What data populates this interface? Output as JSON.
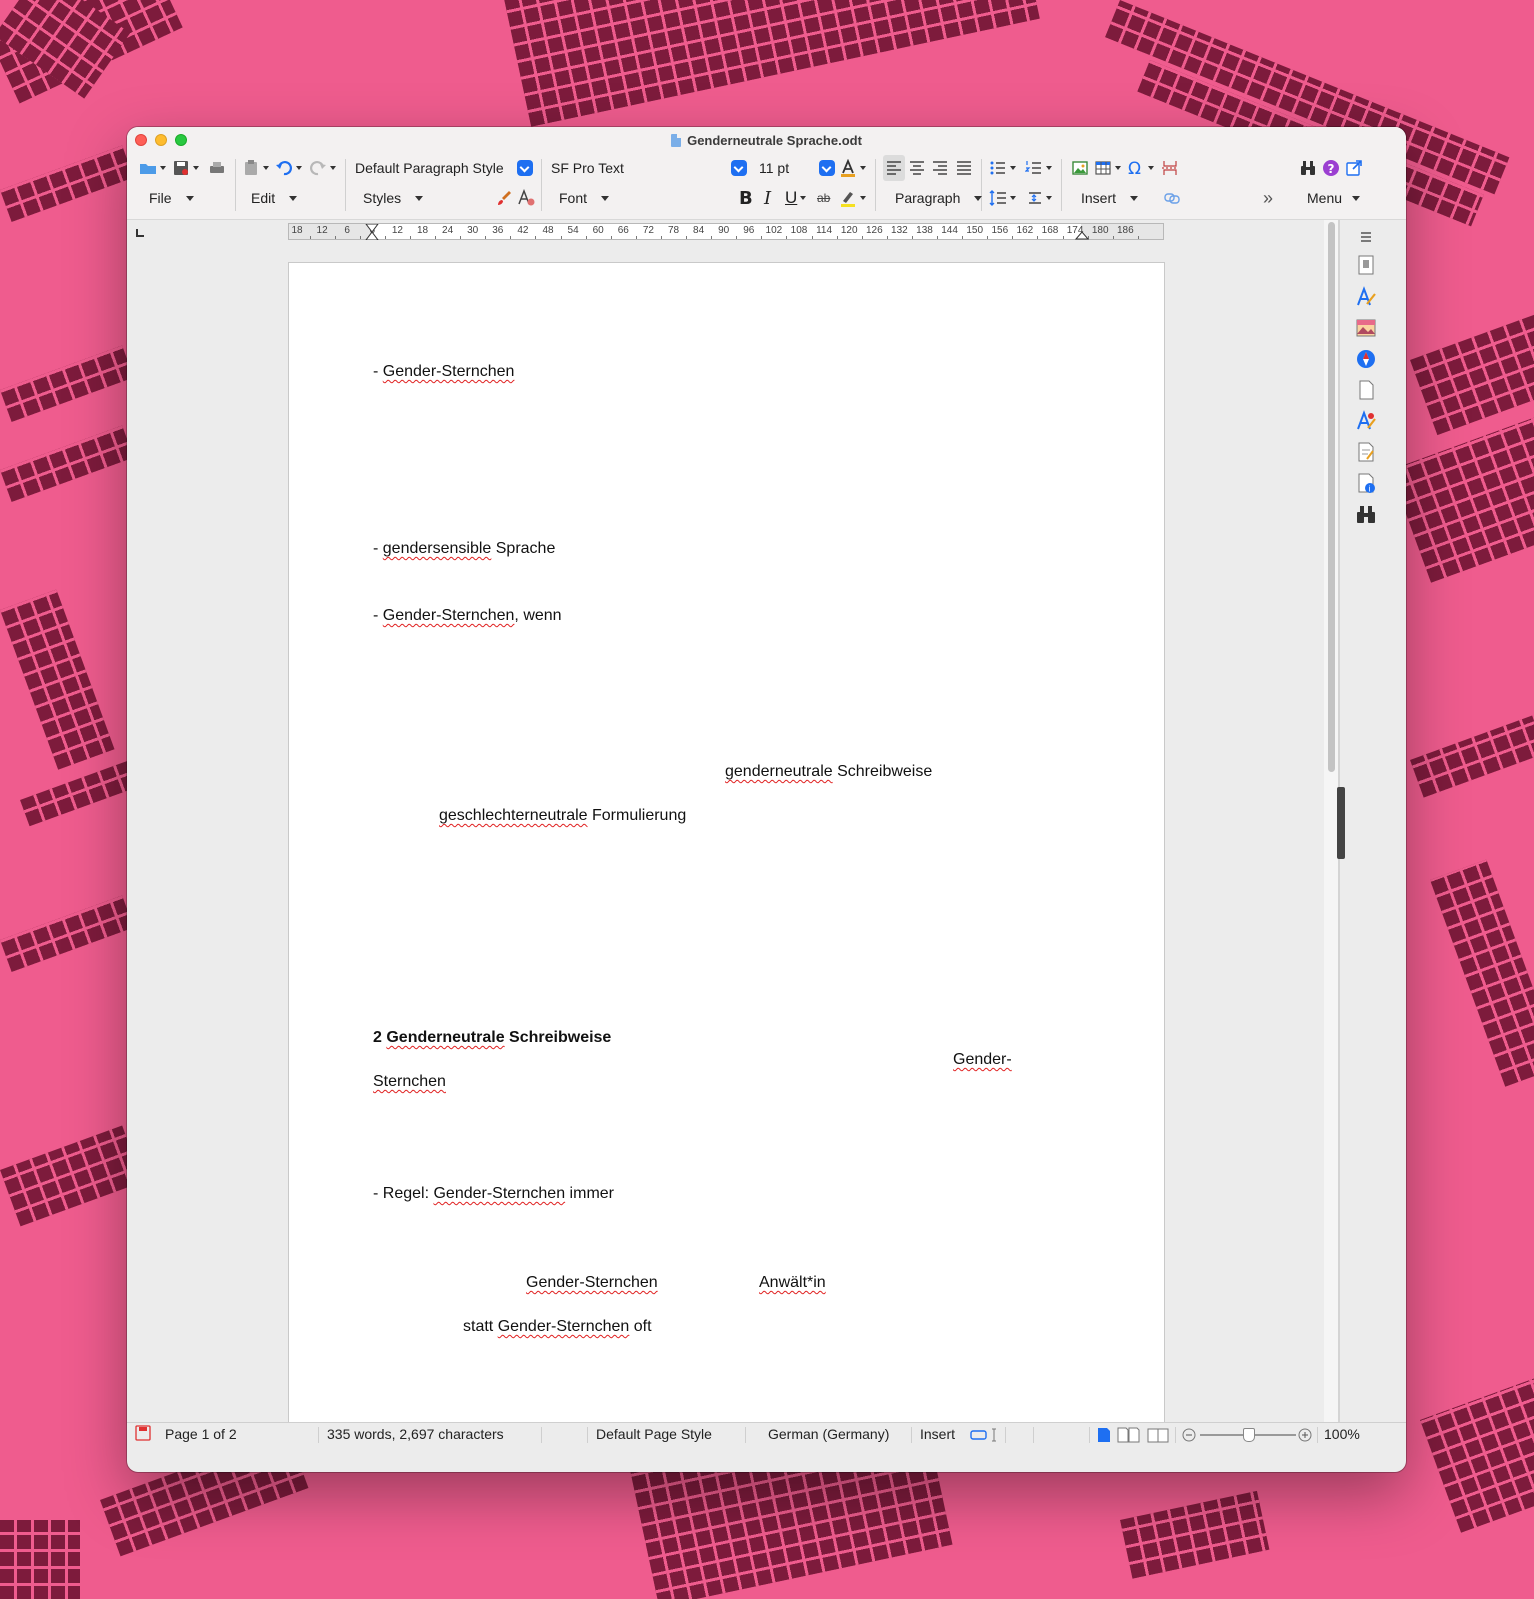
{
  "window": {
    "title": "Genderneutrale Sprache.odt"
  },
  "toolbar": {
    "groups": {
      "file": "File",
      "edit": "Edit",
      "styles": "Styles",
      "font": "Font",
      "paragraph": "Paragraph",
      "insert": "Insert",
      "menu": "Menu"
    },
    "paragraph_style": "Default Paragraph Style",
    "font_name": "SF Pro Text",
    "font_size": "11 pt",
    "overflow": "»"
  },
  "ruler": {
    "labels": [
      "18",
      "12",
      "6",
      "6",
      "12",
      "18",
      "24",
      "30",
      "36",
      "42",
      "48",
      "54",
      "60",
      "66",
      "72",
      "78",
      "84",
      "90",
      "96",
      "102",
      "108",
      "114",
      "120",
      "126",
      "132",
      "138",
      "144",
      "150",
      "156",
      "162",
      "168",
      "174",
      "180",
      "186"
    ]
  },
  "document": {
    "paragraphs": [
      {
        "runs": [
          {
            "t": "- "
          },
          {
            "t": "Gender-Sternchen",
            "sq": true
          }
        ]
      },
      {
        "runs": [
          {
            "t": "- "
          },
          {
            "t": "gendersensible",
            "sq": true
          },
          {
            "t": " Sprache"
          }
        ]
      },
      {
        "runs": [
          {
            "t": "- "
          },
          {
            "t": "Gender-Sternchen",
            "sq": true
          },
          {
            "t": ", wenn"
          }
        ]
      },
      {
        "runs": [
          {
            "t": "genderneutrale",
            "sq": true
          },
          {
            "t": " Schreibweise"
          }
        ]
      },
      {
        "runs": [
          {
            "t": "geschlechterneutrale",
            "sq": true
          },
          {
            "t": " Formulierung"
          }
        ]
      },
      {
        "runs": [
          {
            "t": "2 "
          },
          {
            "t": "Genderneutrale",
            "sq": true
          },
          {
            "t": " Schreibweise"
          }
        ],
        "bold": true
      },
      {
        "runs": [
          {
            "t": "Gender-",
            "sq": true
          }
        ]
      },
      {
        "runs": [
          {
            "t": "Sternchen",
            "sq": true
          }
        ]
      },
      {
        "runs": [
          {
            "t": "- Regel: "
          },
          {
            "t": "Gender-Sternchen",
            "sq": true
          },
          {
            "t": " immer"
          }
        ]
      },
      {
        "runs": [
          {
            "t": "Gender-Sternchen",
            "sq": true
          }
        ]
      },
      {
        "runs": [
          {
            "t": "Anwält*in",
            "sq": true
          }
        ]
      },
      {
        "runs": [
          {
            "t": "statt "
          },
          {
            "t": "Gender-Sternchen",
            "sq": true
          },
          {
            "t": " oft"
          }
        ]
      }
    ]
  },
  "statusbar": {
    "page": "Page 1 of 2",
    "words": "335 words, 2,697 characters",
    "page_style": "Default Page Style",
    "language": "German (Germany)",
    "mode": "Insert",
    "zoom": "100%",
    "zoom_level": 1.0
  },
  "colors": {
    "accent": "#1e6ff1",
    "wallpaper": "#ef5c8e",
    "wallpaper_blocks": "#7d1b3c",
    "spellcheck": "#e02020"
  }
}
